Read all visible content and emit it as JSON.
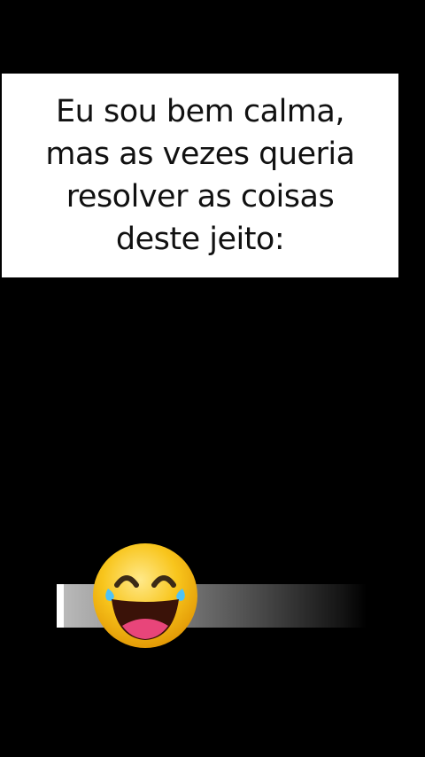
{
  "caption": {
    "lines": [
      "Eu sou bem calma,",
      "mas as vezes queria",
      "resolver as coisas",
      "deste jeito:"
    ]
  },
  "progress": {
    "fraction": 0.12
  },
  "icons": {
    "emoji": "laughing-with-tears-emoji-icon"
  },
  "colors": {
    "background": "#000000",
    "card": "#ffffff",
    "text": "#111111",
    "emoji_face": "#f6c21a",
    "emoji_tongue": "#e8457a",
    "emoji_tears": "#4fc3f7"
  }
}
